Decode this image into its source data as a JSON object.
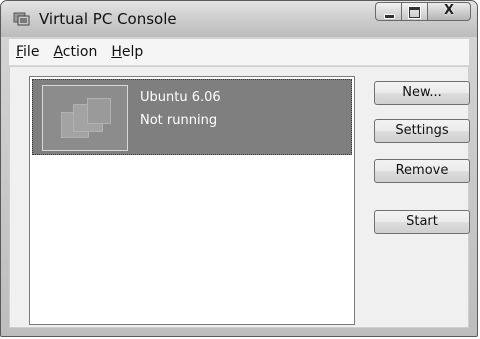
{
  "window": {
    "title": "Virtual PC Console",
    "app_icon": "virtual-pc-icon"
  },
  "caption_buttons": {
    "minimize_icon": "minimize-icon",
    "maximize_icon": "maximize-icon",
    "close_icon": "close-icon",
    "close_glyph": "X"
  },
  "menu": [
    {
      "label": "File",
      "mnemonic": "F"
    },
    {
      "label": "Action",
      "mnemonic": "A"
    },
    {
      "label": "Help",
      "mnemonic": "H"
    }
  ],
  "vm_list": {
    "items": [
      {
        "name": "Ubuntu 6.06",
        "status": "Not running",
        "selected": true,
        "thumbnail_icon": "vm-thumbnail-icon"
      }
    ]
  },
  "buttons": {
    "new": "New...",
    "settings": "Settings",
    "remove": "Remove",
    "start": "Start"
  },
  "colors": {
    "selection": "#7f7f7f",
    "selection_text": "#ffffff",
    "chrome": "#d0d0d0"
  }
}
